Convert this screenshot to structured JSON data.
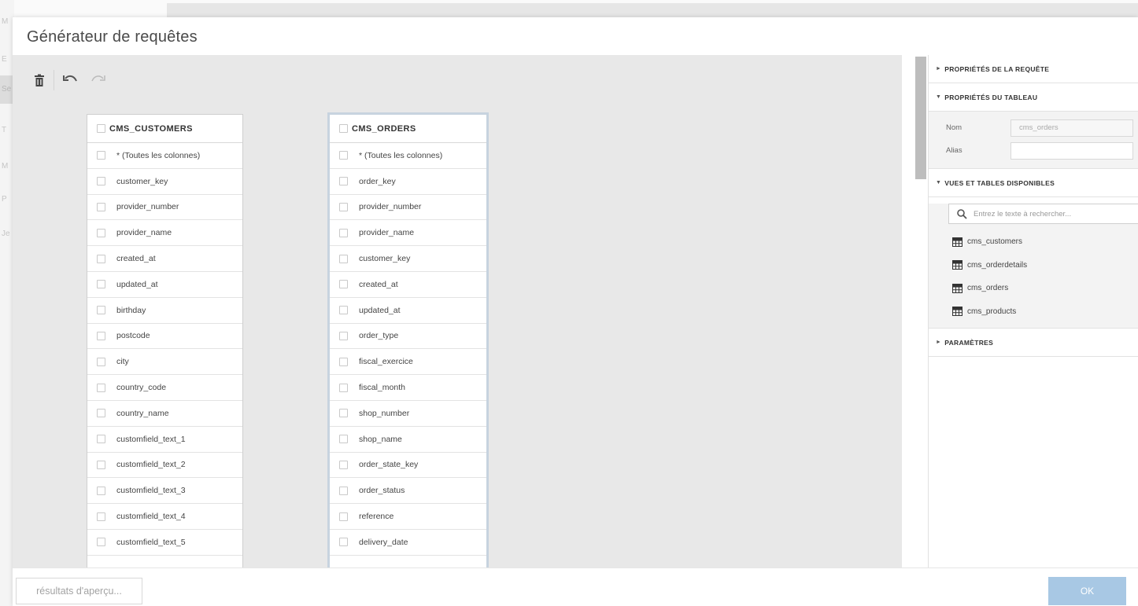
{
  "background_nav": {
    "items": [
      "M",
      "E",
      "Se",
      "T",
      "M",
      "P",
      "Je"
    ]
  },
  "modal": {
    "title": "Générateur de requêtes"
  },
  "toolbar": {
    "delete_icon": "trash-icon",
    "undo_icon": "undo-icon",
    "redo_icon": "redo-icon"
  },
  "tables": [
    {
      "name": "CMS_CUSTOMERS",
      "columns": [
        "* (Toutes les colonnes)",
        "customer_key",
        "provider_number",
        "provider_name",
        "created_at",
        "updated_at",
        "birthday",
        "postcode",
        "city",
        "country_code",
        "country_name",
        "customfield_text_1",
        "customfield_text_2",
        "customfield_text_3",
        "customfield_text_4",
        "customfield_text_5"
      ]
    },
    {
      "name": "CMS_ORDERS",
      "columns": [
        "* (Toutes les colonnes)",
        "order_key",
        "provider_number",
        "provider_name",
        "customer_key",
        "created_at",
        "updated_at",
        "order_type",
        "fiscal_exercice",
        "fiscal_month",
        "shop_number",
        "shop_name",
        "order_state_key",
        "order_status",
        "reference",
        "delivery_date"
      ]
    }
  ],
  "panel": {
    "query_props": "PROPRIÉTÉS DE LA REQUÊTE",
    "table_props": "PROPRIÉTÉS DU TABLEAU",
    "name_label": "Nom",
    "name_value": "cms_orders",
    "alias_label": "Alias",
    "alias_value": "",
    "views_tables": "VUES ET TABLES DISPONIBLES",
    "search_placeholder": "Entrez le texte à rechercher...",
    "available_tables": [
      "cms_customers",
      "cms_orderdetails",
      "cms_orders",
      "cms_products"
    ],
    "parameters": "PARAMÈTRES"
  },
  "footer": {
    "preview_label": "résultats d'aperçu...",
    "ok_label": "OK"
  },
  "colors": {
    "ok_button": "#a8c8e4",
    "canvas": "#e8e8e8",
    "selected_table_border": "#c7d3df"
  }
}
